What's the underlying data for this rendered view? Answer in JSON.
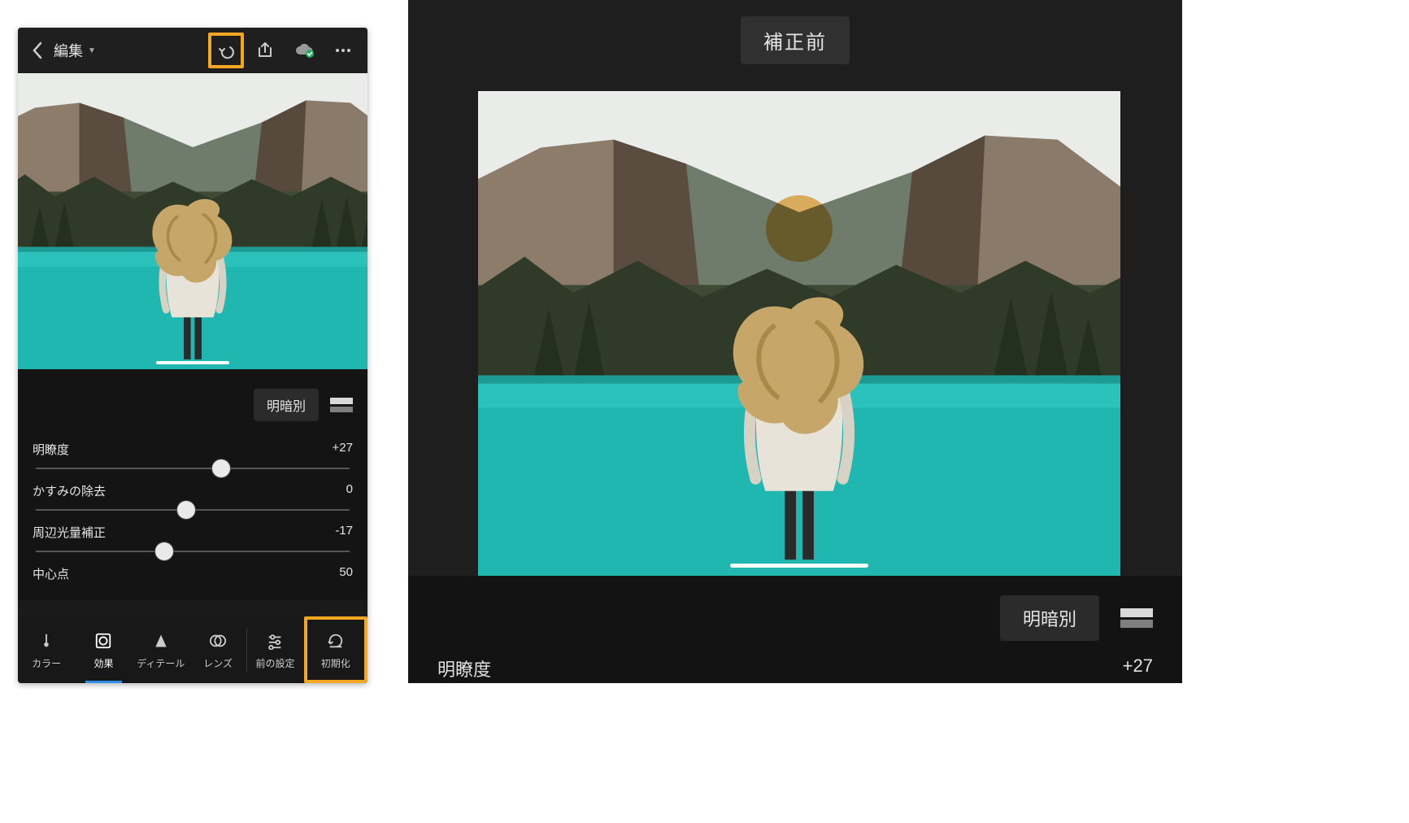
{
  "header": {
    "title": "編集",
    "before_label": "補正前"
  },
  "split": {
    "label": "明暗別"
  },
  "sliders": [
    {
      "label": "明瞭度",
      "value": "+27",
      "pos": 59
    },
    {
      "label": "かすみの除去",
      "value": "0",
      "pos": 48
    },
    {
      "label": "周辺光量補正",
      "value": "-17",
      "pos": 41
    },
    {
      "label": "中心点",
      "value": "50",
      "pos": null
    }
  ],
  "tabs": [
    {
      "id": "color",
      "label": "カラー"
    },
    {
      "id": "effect",
      "label": "効果"
    },
    {
      "id": "detail",
      "label": "ディテール"
    },
    {
      "id": "lens",
      "label": "レンズ"
    },
    {
      "id": "previous",
      "label": "前の設定"
    },
    {
      "id": "reset",
      "label": "初期化"
    }
  ],
  "right_slider": {
    "label": "明瞭度",
    "value": "+27"
  }
}
